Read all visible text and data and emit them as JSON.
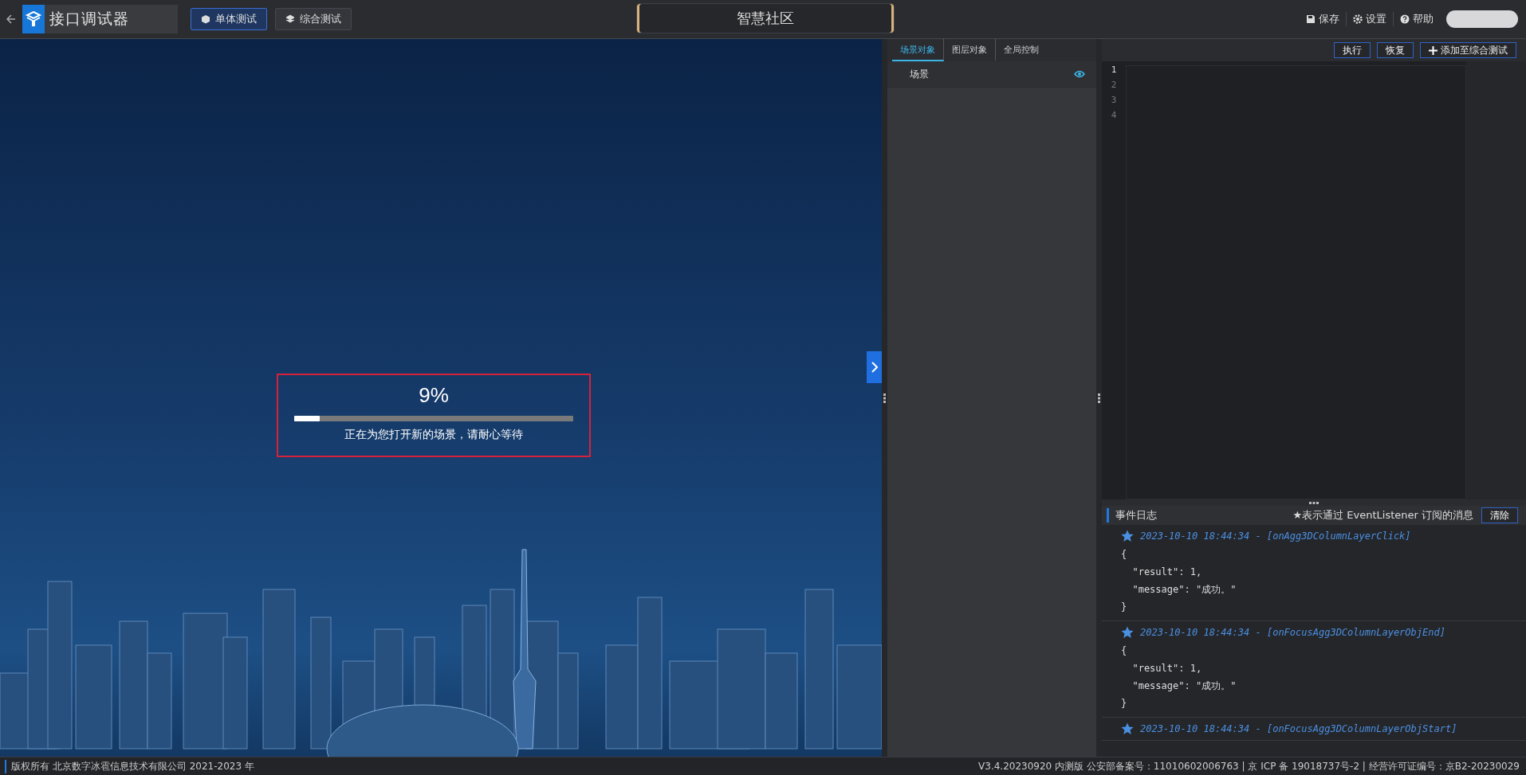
{
  "app": {
    "title": "接口调试器"
  },
  "mode_tabs": [
    {
      "label": "单体测试",
      "selected": true
    },
    {
      "label": "综合测试",
      "selected": false
    }
  ],
  "scene_title": "智慧社区",
  "header_actions": [
    {
      "label": "保存"
    },
    {
      "label": "设置"
    },
    {
      "label": "帮助"
    }
  ],
  "loading": {
    "percent": "9%",
    "level": 0.09,
    "message": "正在为您打开新的场景，请耐心等待"
  },
  "object_tabs": [
    {
      "label": "场景对象",
      "selected": true
    },
    {
      "label": "图层对象",
      "selected": false
    },
    {
      "label": "全局控制",
      "selected": false
    }
  ],
  "scene_tree": [
    {
      "label": "场景",
      "visible": true
    }
  ],
  "editor": {
    "buttons": [
      {
        "label": "执行"
      },
      {
        "label": "恢复"
      },
      {
        "label": "添加至综合测试"
      }
    ],
    "line_numbers": [
      "1",
      "2",
      "3",
      "4"
    ]
  },
  "event_log": {
    "title": "事件日志",
    "legend": "★表示通过 EventListener 订阅的消息",
    "clear_button": "清除",
    "entries": [
      {
        "header": "2023-10-10 18:44:34 - [onAgg3DColumnLayerClick]",
        "body": [
          "{",
          "  \"result\": 1,",
          "  \"message\": \"成功。\"",
          "}"
        ]
      },
      {
        "header": "2023-10-10 18:44:34 - [onFocusAgg3DColumnLayerObjEnd]",
        "body": [
          "{",
          "  \"result\": 1,",
          "  \"message\": \"成功。\"",
          "}"
        ]
      },
      {
        "header": "2023-10-10 18:44:34 - [onFocusAgg3DColumnLayerObjStart]"
      }
    ]
  },
  "status_bar": {
    "copyright": "版权所有 北京数字冰雹信息技术有限公司 2021-2023 年",
    "info": "V3.4.20230920 内测版 公安部备案号：11010602006763 | 京 ICP 备 19018737号-2 | 经营许可证编号：京B2-20230029"
  }
}
